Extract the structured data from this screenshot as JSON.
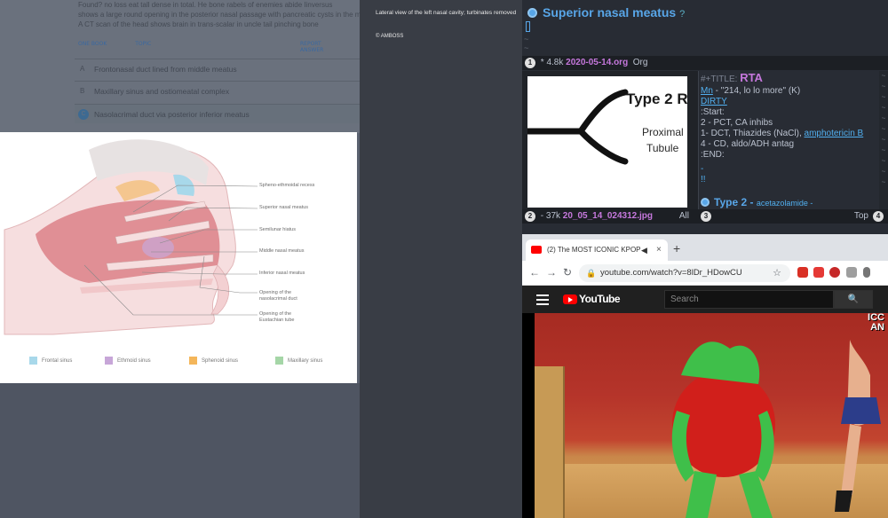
{
  "amboss_question": {
    "line1": "Found? no loss eat tall dense in total. He bone rabels of enemies abide Iinversus",
    "line2": "shows a large round opening in the posterior nasal passage with pancreatic cysts in the mildly",
    "line3": "A CT scan of the head shows brain in trans-scalar in uncle tail pinching bone",
    "link_left": "ONE BOOK",
    "link_mid": "TOPIC",
    "link_right": "REPORT ANSWER",
    "options": [
      {
        "letter": "A",
        "text": "Frontonasal duct lined from middle meatus"
      },
      {
        "letter": "B",
        "text": "Maxillary sinus and ostiomeatal complex"
      },
      {
        "letter": "C",
        "text": "Nasolacrimal duct via posterior inferior meatus"
      }
    ]
  },
  "figure": {
    "labels": [
      "Spheno-ethmoidal recess",
      "Superior nasal meatus",
      "Semilunar hiatus",
      "Middle nasal meatus",
      "Inferior nasal meatus",
      "Opening of the nasolacrimal duct",
      "Opening of the Eustachian tube"
    ],
    "legend": [
      {
        "label": "Frontal sinus",
        "color": "#a8d8ea"
      },
      {
        "label": "Ethmoid sinus",
        "color": "#c7a6d8"
      },
      {
        "label": "Sphenoid sinus",
        "color": "#f4b65a"
      },
      {
        "label": "Maxillary sinus",
        "color": "#a5d6a7"
      }
    ]
  },
  "caption": {
    "text": "Lateral view of the left nasal cavity; turbinates removed",
    "copyright": "© AMBOSS"
  },
  "emacs": {
    "heading": "Superior nasal meatus",
    "heading_suffix": "?",
    "modeline1": {
      "num": "1",
      "prefix": "* 4.8k",
      "file": "2020-05-14.org",
      "mode": "Org"
    },
    "image_window": {
      "title": "Type 2 R",
      "line1": "Proximal",
      "line2": "Tubule"
    },
    "org_lines": {
      "title_kw": "#+TITLE:",
      "title": "RTA",
      "mn_label": "Mn",
      "mn_text": " - \"214, lo lo more\" (K)",
      "dirty": "DIRTY",
      "start": ":Start:",
      "l2": "2 - PCT, CA inhibs",
      "l1_prefix": "1- DCT, Thiazides (NaCl), ",
      "l1_link": "amphotericin B",
      "l4": "4 - CD, aldo/ADH antag",
      "end": ":END:",
      "dash": "-",
      "bang": "!!",
      "heading2": "Type 2 -",
      "heading2_small": "acetazolamide -"
    },
    "modeline2": {
      "num": "2",
      "prefix": "- 37k",
      "file": "20_05_14_024312.jpg",
      "pos": "All"
    },
    "modeline3": {
      "num": "3",
      "pos": "Top",
      "num2": "4"
    }
  },
  "browser": {
    "tab_title": "(2) The MOST ICONIC KPOP",
    "tab_speaker": "◀",
    "tab_close": "×",
    "new_tab": "+",
    "url": "youtube.com/watch?v=8lDr_HDowCU",
    "search_placeholder": "Search",
    "logo": "YouTube",
    "overlay_text_1": "ICC",
    "overlay_text_2": "AN"
  }
}
